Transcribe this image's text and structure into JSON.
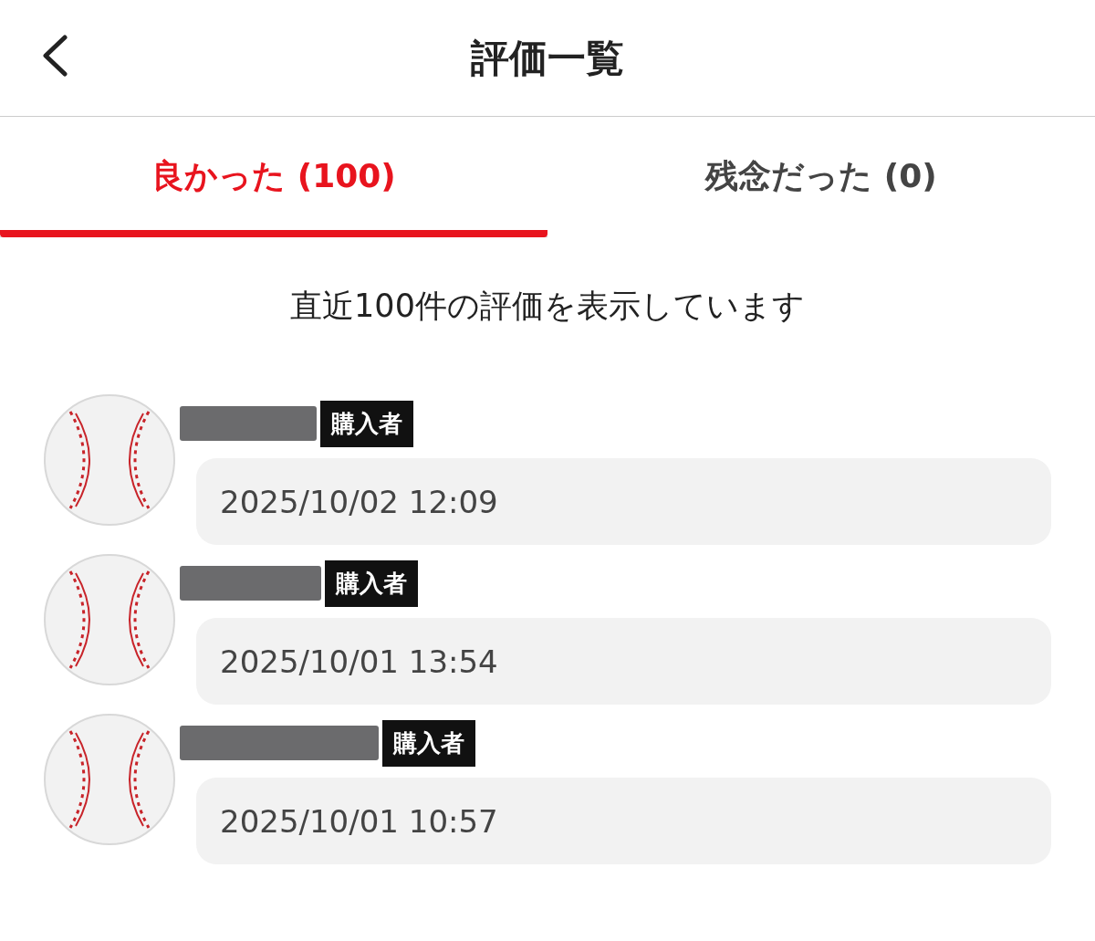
{
  "header": {
    "title": "評価一覧"
  },
  "tabs": [
    {
      "label": "良かった (100)",
      "selected": true
    },
    {
      "label": "残念だった (0)",
      "selected": false
    }
  ],
  "notice": "直近100件の評価を表示しています",
  "reviews": [
    {
      "badge": "購入者",
      "date": "2025/10/02 12:09"
    },
    {
      "badge": "購入者",
      "date": "2025/10/01 13:54"
    },
    {
      "badge": "購入者",
      "date": "2025/10/01 10:57"
    }
  ]
}
